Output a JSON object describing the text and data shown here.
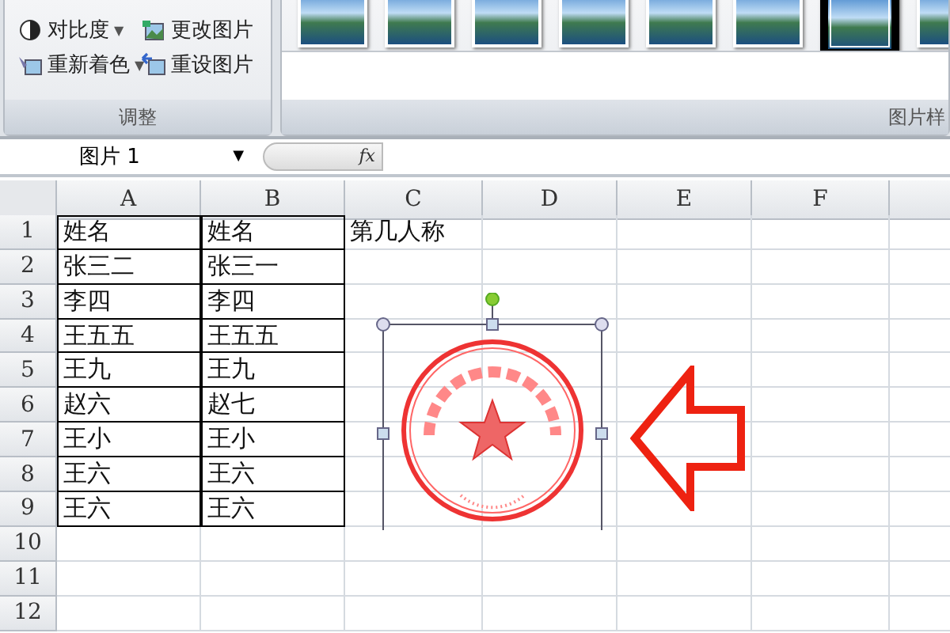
{
  "ribbon": {
    "adjust_group": {
      "buttons": [
        {
          "label": "对比度",
          "caret": "▼"
        },
        {
          "label": "更改图片"
        },
        {
          "label": "重新着色",
          "caret": "▼"
        },
        {
          "label": "重设图片"
        }
      ],
      "label": "调整"
    },
    "styles_group": {
      "styles": [
        {
          "selected": false
        },
        {
          "selected": false
        },
        {
          "selected": false
        },
        {
          "selected": false
        },
        {
          "selected": false
        },
        {
          "selected": false
        },
        {
          "selected": true
        },
        {
          "selected": false
        }
      ],
      "label": "图片样"
    }
  },
  "formula_bar": {
    "name_box": "图片 1",
    "name_box_caret": "▼",
    "fx": "fx"
  },
  "sheet": {
    "columns": [
      "A",
      "B",
      "C",
      "D",
      "E",
      "F"
    ],
    "rows": [
      {
        "number": "1",
        "outlined": true,
        "cells": [
          "姓名",
          "姓名",
          "第几人称"
        ]
      },
      {
        "number": "2",
        "outlined": true,
        "cells": [
          "张三二",
          "张三一"
        ]
      },
      {
        "number": "3",
        "outlined": true,
        "cells": [
          "李四",
          "李四"
        ]
      },
      {
        "number": "4",
        "outlined": true,
        "cells": [
          "王五五",
          "王五五"
        ]
      },
      {
        "number": "5",
        "outlined": true,
        "cells": [
          "王九",
          "王九"
        ]
      },
      {
        "number": "6",
        "outlined": true,
        "cells": [
          "赵六",
          "赵七"
        ]
      },
      {
        "number": "7",
        "outlined": true,
        "cells": [
          "王小",
          "王小"
        ]
      },
      {
        "number": "8",
        "outlined": true,
        "cells": [
          "王六",
          "王六"
        ]
      },
      {
        "number": "9",
        "outlined": true,
        "cells": [
          "王六",
          "王六"
        ]
      },
      {
        "number": "10",
        "outlined": false,
        "cells": []
      },
      {
        "number": "11",
        "outlined": false,
        "cells": []
      },
      {
        "number": "12",
        "outlined": false,
        "cells": []
      }
    ]
  }
}
